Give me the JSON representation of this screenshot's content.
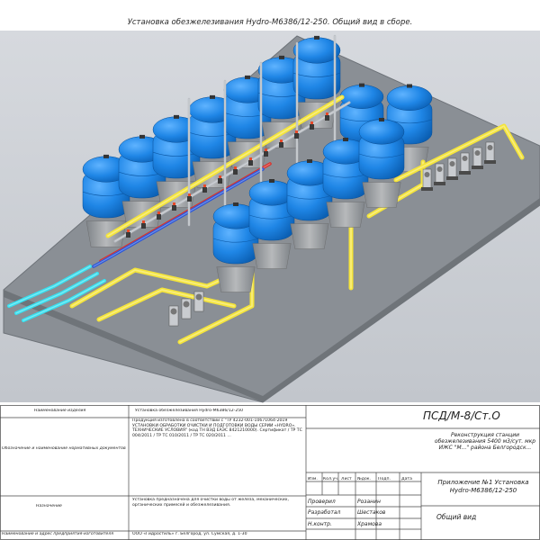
{
  "drawing": {
    "header": "Установка обезжелезивания Hydro-M6386/12-250. Общий вид в сборе."
  },
  "title_block": {
    "left_labels": {
      "product_name": "Наименование изделия",
      "standards": "Обозначение и наименование нормативных документов",
      "purpose": "Назначение",
      "manufacturer": "Наименование и адрес предприятия-изготовителя"
    },
    "product_value": "Установка обезжелезивания Hydro-M6386/12-250",
    "standards_value": "Продукция изготовлена в соответствии с \"ТУ 4232-001-10671064-2019 УСТАНОВКИ ОБРАБОТКИ ОЧИСТКИ И ПОДГОТОВКИ ВОДЫ СЕРИИ «HYDRO». ТЕХНИЧЕСКИЕ УСЛОВИЯ\" (код ТН ВЭД ЕАЭС 8421210000). Сертификат / ТР ТС 004/2011 / ТР ТС 010/2011 / ТР ТС 020/2011 ...",
    "purpose_value": "Установка предназначена для очистки воды от железа, механических, органических примесей и обезжелезивания.",
    "manufacturer_value": "ООО «Гидростиль» г. Белгород, ул. Сумская, д. 1-30",
    "code": "ПСД/М-8/Ст.О",
    "object": "Реконструкция станции обезжелезивания 5400 м3/сут. мкр ИЖС \"М...\" района Белгородск...",
    "appendix": "Приложение №1 Установка Hydro-M6386/12-250",
    "sheet_title": "Общий вид",
    "stamp_headers": [
      "Изм.",
      "Кол.уч.",
      "Лист",
      "№док.",
      "Подп.",
      "Дата"
    ],
    "roles": [
      "Проверил",
      "Разработал",
      "Н.контр."
    ],
    "names": [
      "Розанин",
      "Шестаков",
      "Храмова"
    ]
  },
  "colors": {
    "background": "#ffffff",
    "viewport": "#c9cdd3",
    "base_plate": "#8a8f95",
    "vessel": "#1f86e6",
    "vessel_base": "#9a9a9a",
    "pipe_yellow": "#f4e43a",
    "pipe_cyan": "#36e0f0",
    "pipe_red": "#d8302a",
    "pipe_blue": "#2a56d8",
    "pipe_gray": "#b8bcc2"
  },
  "icons": [
    "filter-vessel-icon",
    "pump-unit-icon",
    "valve-icon"
  ]
}
